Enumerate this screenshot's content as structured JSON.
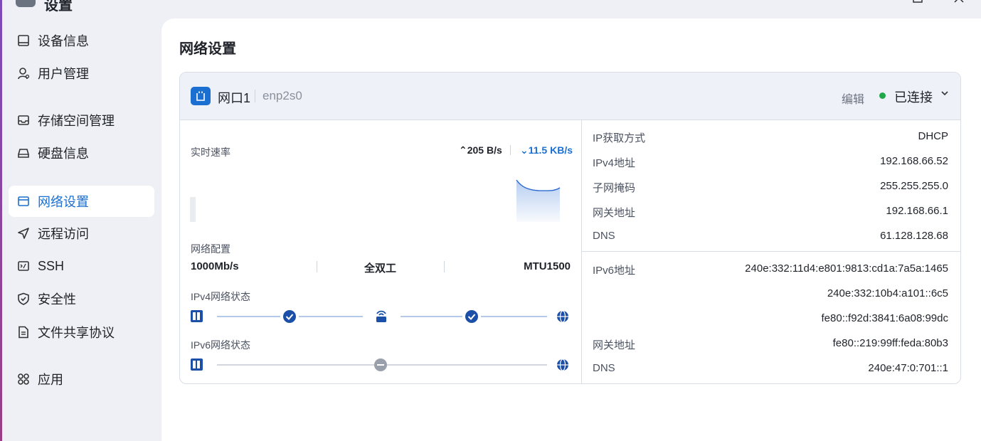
{
  "window": {
    "title": "设置"
  },
  "sidebar": {
    "items": [
      {
        "label": "设备信息"
      },
      {
        "label": "用户管理"
      },
      {
        "label": "存储空间管理"
      },
      {
        "label": "硬盘信息"
      },
      {
        "label": "网络设置",
        "active": true
      },
      {
        "label": "远程访问"
      },
      {
        "label": "SSH"
      },
      {
        "label": "安全性"
      },
      {
        "label": "文件共享协议"
      },
      {
        "label": "应用"
      }
    ]
  },
  "page": {
    "title": "网络设置"
  },
  "port": {
    "name": "网口1",
    "device": "enp2s0",
    "edit_label": "编辑",
    "status": "已连接",
    "status_color": "#1fa84a"
  },
  "speed": {
    "label": "实时速率",
    "up": "205 B/s",
    "down": "11.5 KB/s"
  },
  "config": {
    "label": "网络配置",
    "rate": "1000Mb/s",
    "duplex": "全双工",
    "mtu": "MTU1500"
  },
  "ipv4_status": {
    "label": "IPv4网络状态"
  },
  "ipv6_status": {
    "label": "IPv6网络状态"
  },
  "ipv4": {
    "method_label": "IP获取方式",
    "method": "DHCP",
    "addr_label": "IPv4地址",
    "addr": "192.168.66.52",
    "mask_label": "子网掩码",
    "mask": "255.255.255.0",
    "gw_label": "网关地址",
    "gw": "192.168.66.1",
    "dns_label": "DNS",
    "dns": "61.128.128.68"
  },
  "ipv6": {
    "addr_label": "IPv6地址",
    "addrs": [
      "240e:332:11d4:e801:9813:cd1a:7a5a:1465",
      "240e:332:10b4:a101::6c5",
      "fe80::f92d:3841:6a08:99dc"
    ],
    "gw_label": "网关地址",
    "gw": "fe80::219:99ff:feda:80b3",
    "dns_label": "DNS",
    "dns": "240e:47:0:701::1"
  },
  "colors": {
    "accent": "#1b6fd1",
    "connected": "#1fa84a"
  }
}
